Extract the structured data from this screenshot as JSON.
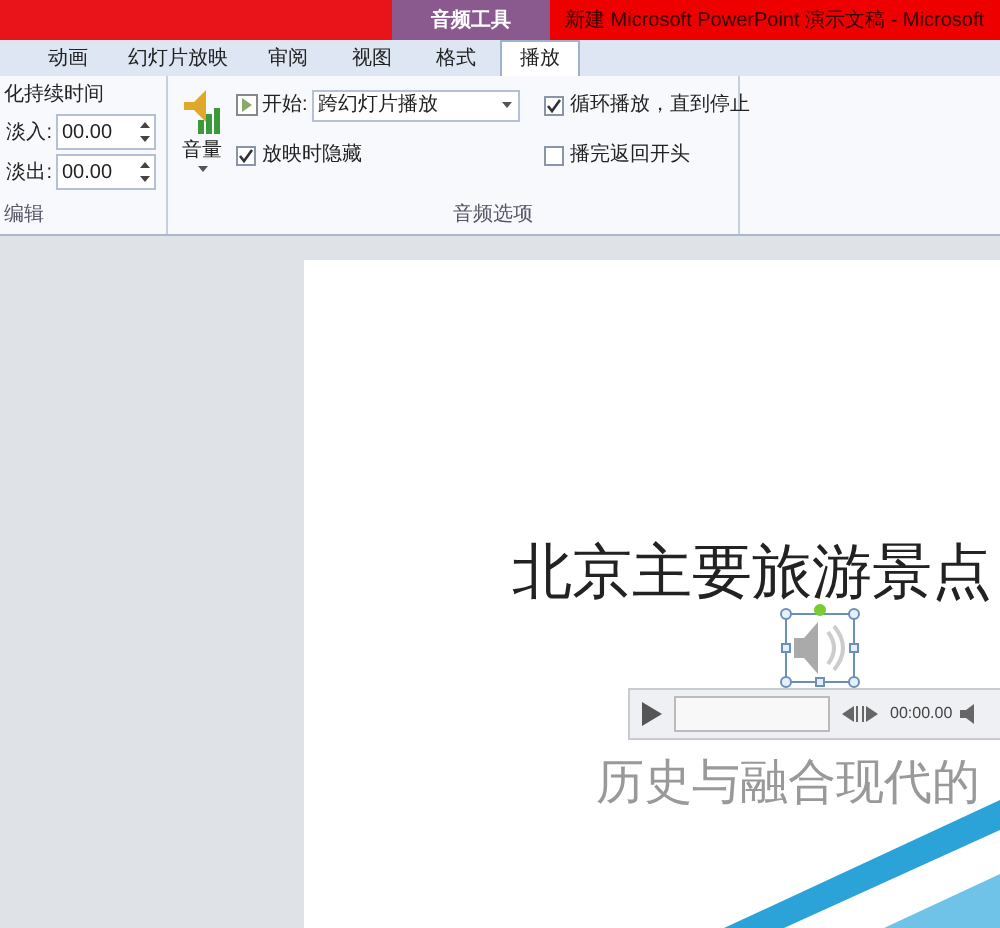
{
  "title_bar": {
    "context_tab": "音频工具",
    "title": "新建 Microsoft PowerPoint 演示文稿 - Microsoft"
  },
  "tabs": [
    {
      "label": "动画",
      "selected": false
    },
    {
      "label": "幻灯片放映",
      "selected": false
    },
    {
      "label": "审阅",
      "selected": false
    },
    {
      "label": "视图",
      "selected": false
    },
    {
      "label": "格式",
      "selected": false
    },
    {
      "label": "播放",
      "selected": true
    }
  ],
  "ribbon": {
    "edit_group": {
      "heading": "化持续时间",
      "fields": [
        {
          "label": "淡入:",
          "value": "00.00"
        },
        {
          "label": "淡出:",
          "value": "00.00"
        }
      ],
      "label": "编辑"
    },
    "audio_group": {
      "volume": "音量",
      "start_label": "开始:",
      "start_value": "跨幻灯片播放",
      "checkboxes": [
        {
          "label": "放映时隐藏",
          "checked": true
        },
        {
          "label": "循环播放，直到停止",
          "checked": true
        },
        {
          "label": "播完返回开头",
          "checked": false
        }
      ],
      "label": "音频选项"
    }
  },
  "slide": {
    "title": "北京主要旅游景点",
    "subtitle": "历史与融合现代的",
    "player": {
      "time": "00:00.00"
    }
  }
}
